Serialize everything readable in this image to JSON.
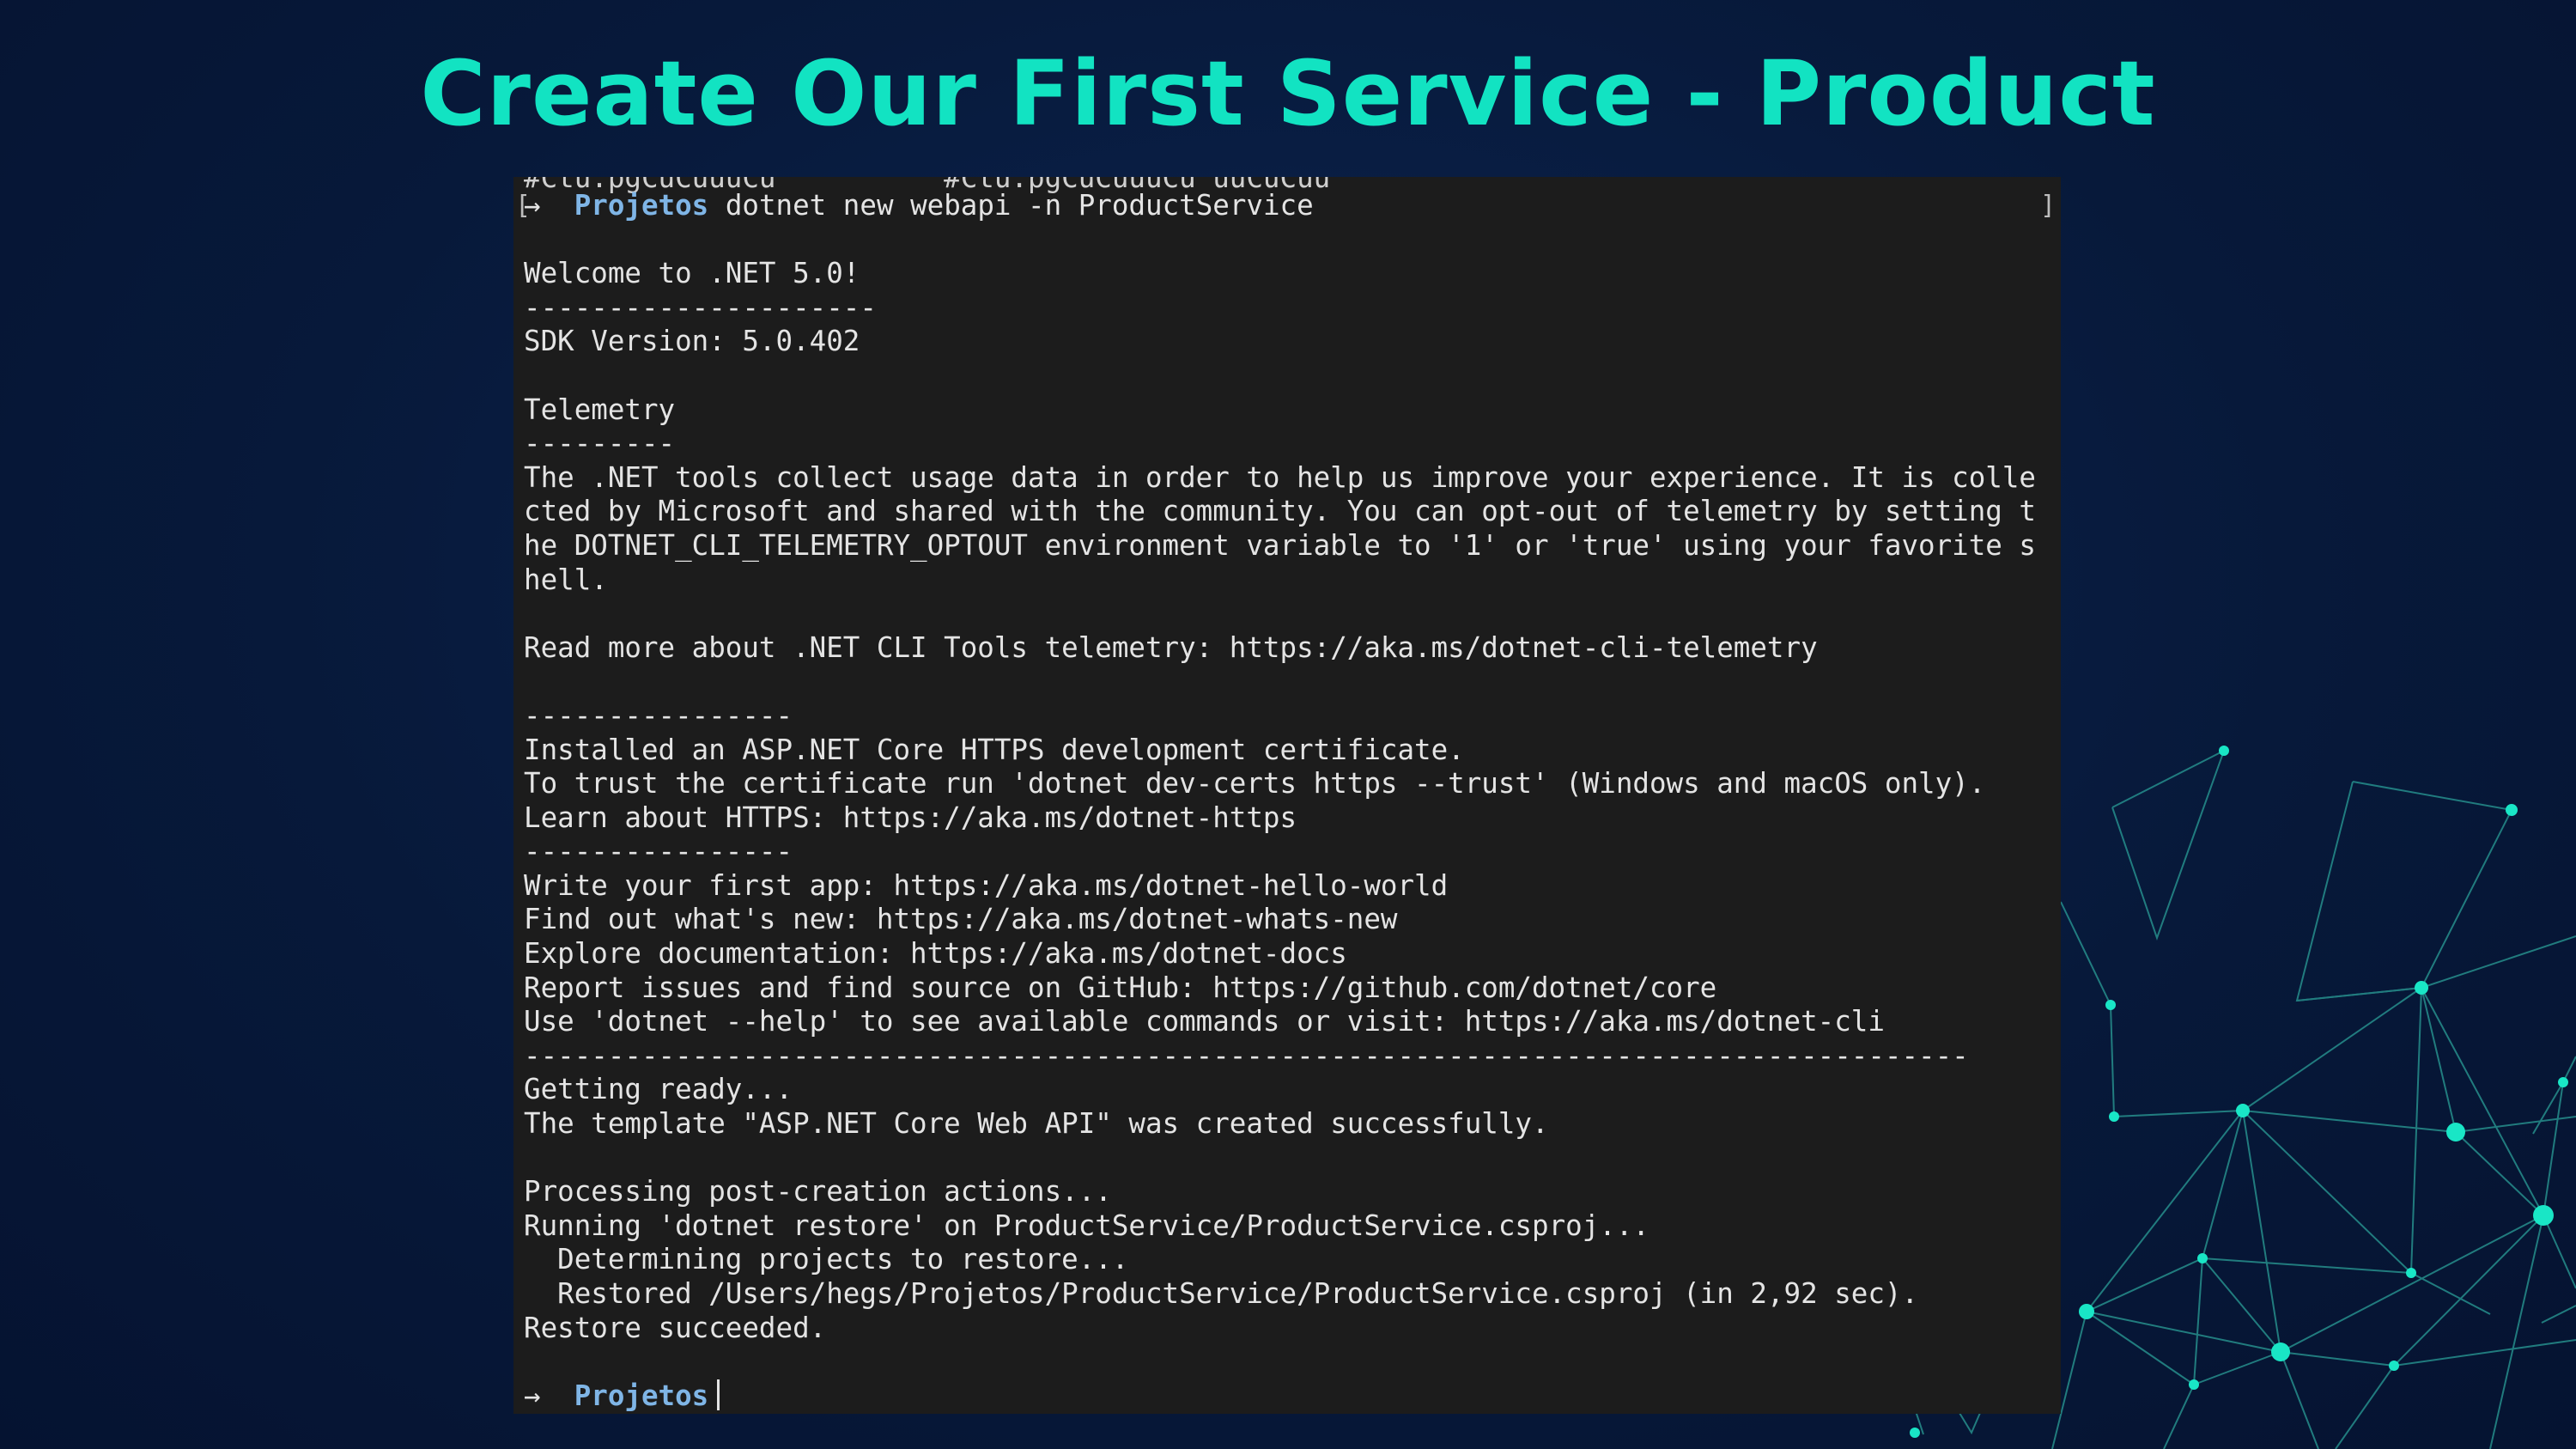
{
  "slide": {
    "title": "Create Our First Service - Product"
  },
  "terminal": {
    "top_cut_line": "#Ctu:pgCuCuuuCu          #Ctu:pgCuCuuuCu uuCuCuu",
    "prompt_arrow": "→",
    "prompt_dir": "Projetos",
    "command": "dotnet new webapi -n ProductService",
    "lines": [
      "",
      "Welcome to .NET 5.0!",
      "---------------------",
      "SDK Version: 5.0.402",
      "",
      "Telemetry",
      "---------",
      "The .NET tools collect usage data in order to help us improve your experience. It is colle",
      "cted by Microsoft and shared with the community. You can opt-out of telemetry by setting t",
      "he DOTNET_CLI_TELEMETRY_OPTOUT environment variable to '1' or 'true' using your favorite s",
      "hell.",
      "",
      "Read more about .NET CLI Tools telemetry: https://aka.ms/dotnet-cli-telemetry",
      "",
      "----------------",
      "Installed an ASP.NET Core HTTPS development certificate.",
      "To trust the certificate run 'dotnet dev-certs https --trust' (Windows and macOS only).",
      "Learn about HTTPS: https://aka.ms/dotnet-https",
      "----------------",
      "Write your first app: https://aka.ms/dotnet-hello-world",
      "Find out what's new: https://aka.ms/dotnet-whats-new",
      "Explore documentation: https://aka.ms/dotnet-docs",
      "Report issues and find source on GitHub: https://github.com/dotnet/core",
      "Use 'dotnet --help' to see available commands or visit: https://aka.ms/dotnet-cli",
      "--------------------------------------------------------------------------------------",
      "Getting ready...",
      "The template \"ASP.NET Core Web API\" was created successfully.",
      "",
      "Processing post-creation actions...",
      "Running 'dotnet restore' on ProductService/ProductService.csproj...",
      "  Determining projects to restore...",
      "  Restored /Users/hegs/Projetos/ProductService/ProductService.csproj (in 2,92 sec).",
      "Restore succeeded.",
      ""
    ],
    "final_prompt_arrow": "→",
    "final_prompt_dir": "Projetos"
  },
  "colors": {
    "title": "#12e3c2",
    "background": "#07193a",
    "terminal_bg": "#1c1c1c",
    "prompt_dir": "#7fb5e6",
    "network_lines": "#2fa8a0",
    "network_nodes": "#19e6c6"
  }
}
